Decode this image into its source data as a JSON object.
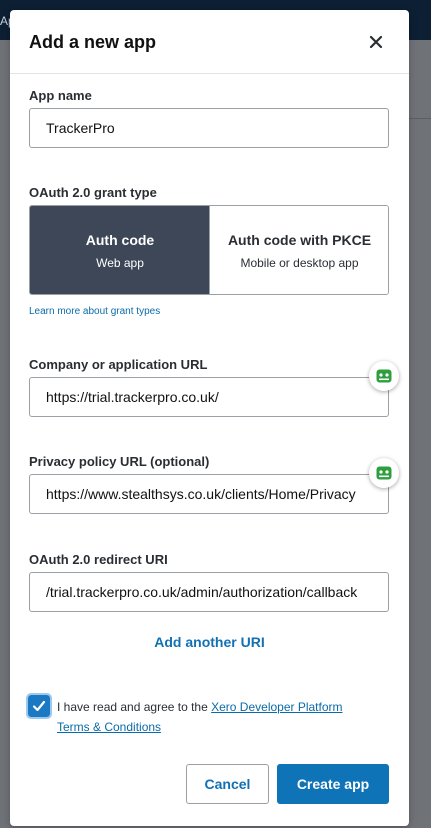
{
  "background": {
    "topbar_text": "Ap"
  },
  "modal": {
    "title": "Add a new app"
  },
  "form": {
    "app_name": {
      "label": "App name",
      "value": "TrackerPro"
    },
    "grant_type": {
      "label": "OAuth 2.0 grant type",
      "options": [
        {
          "title": "Auth code",
          "subtitle": "Web app",
          "selected": true
        },
        {
          "title": "Auth code with PKCE",
          "subtitle": "Mobile or desktop app",
          "selected": false
        }
      ],
      "learn_more": "Learn more about grant types"
    },
    "company_url": {
      "label": "Company or application URL",
      "value": "https://trial.trackerpro.co.uk/"
    },
    "privacy_url": {
      "label": "Privacy policy URL (optional)",
      "value": "https://www.stealthsys.co.uk/clients/Home/Privacy"
    },
    "redirect_uri": {
      "label": "OAuth 2.0 redirect URI",
      "value": "/trial.trackerpro.co.uk/admin/authorization/callback"
    },
    "add_uri": "Add another URI",
    "terms": {
      "checked": true,
      "text": "I have read and agree to the ",
      "link": "Xero Developer Platform Terms & Conditions"
    }
  },
  "actions": {
    "cancel": "Cancel",
    "create": "Create app"
  },
  "colors": {
    "primary": "#0f73b8",
    "selected_grant": "#3d4757",
    "link": "#0b6ba8",
    "password_manager_icon": "#2e9e3e"
  }
}
